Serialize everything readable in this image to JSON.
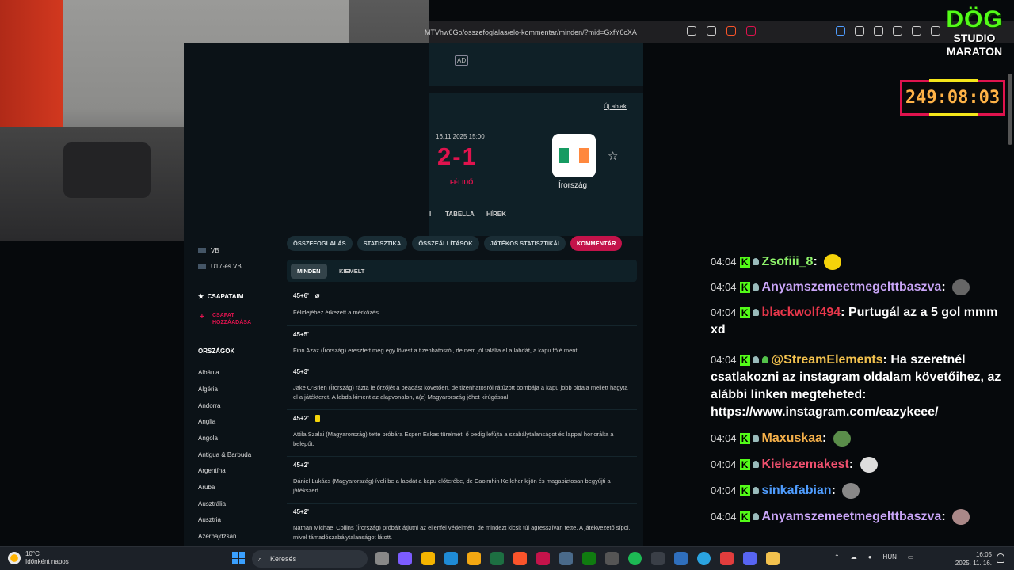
{
  "browser": {
    "url": "MTVhw6Go/osszefoglalas/elo-kommentar/minden/?mid=GxfY6cXA"
  },
  "ad_label": "AD",
  "match": {
    "new_window": "Új ablak",
    "date": "16.11.2025 15:00",
    "score": "2-1",
    "status": "FÉLIDŐ",
    "away_team": "Írország",
    "flag_colors": [
      "#169b62",
      "#ffffff",
      "#ff883e"
    ]
  },
  "tabs": {
    "partial": "I",
    "table": "TABELLA",
    "news": "HÍREK"
  },
  "subtabs": [
    "ÖSSZEFOGLALÁS",
    "STATISZTIKA",
    "ÖSSZEÁLLÍTÁSOK",
    "JÁTÉKOS STATISZTIKÁI",
    "KOMMENTÁR"
  ],
  "filters": {
    "all": "MINDEN",
    "highlighted": "KIEMELT"
  },
  "comments": [
    {
      "time": "45+6'",
      "text": "Félidejéhez érkezett a mérkőzés."
    },
    {
      "time": "45+5'",
      "text": "Finn Azaz (Írország) eresztett meg egy lövést a tizenhatosról, de nem jól találta el a labdát, a kapu fölé ment."
    },
    {
      "time": "45+3'",
      "text": "Jake O'Brien (Írország) rázta le őrzőjét a beadást követően, de tizenhatosról rátűzött bombája a kapu jobb oldala mellett hagyta el a játékteret. A labda kiment az alapvonalon, a(z) Magyarország jöhet kirúgással."
    },
    {
      "time": "45+2'",
      "text": "Attila Szalai (Magyarország) tette próbára Espen Eskas türelmét, ő pedig lefújta a szabálytalanságot és lappal honorálta a belépőt."
    },
    {
      "time": "45+2'",
      "text": "Dániel Lukács (Magyarország) íveli be a labdát a kapu előterébe, de Caoimhin Kelleher kijön és magabiztosan begyűjti a játékszert."
    },
    {
      "time": "45+2'",
      "text": "Nathan Michael Collins (Írország) próbált átjutni az ellenfél védelmén, de mindezt kicsit túl agresszívan tette. A játékvezető sípol, mivel támadószabálytalanságot látott."
    }
  ],
  "leftnav": {
    "competitions": [
      "VB",
      "U17-es VB"
    ],
    "my_teams": "CSAPATAIM",
    "add_team": "CSAPAT HOZZÁADÁSA",
    "countries_header": "ORSZÁGOK",
    "countries": [
      "Albánia",
      "Algéria",
      "Andorra",
      "Anglia",
      "Angola",
      "Antigua & Barbuda",
      "Argentína",
      "Aruba",
      "Ausztrália",
      "Ausztria",
      "Azerbajdzsán"
    ]
  },
  "chat": [
    {
      "time": "04:04",
      "user": "Zsofiii_8",
      "color": "#8ef36b",
      "text": ""
    },
    {
      "time": "04:04",
      "user": "Anyamszemeetmegelttbaszva",
      "color": "#c9a5f7",
      "text": ""
    },
    {
      "time": "04:04",
      "user": "blackwolf494",
      "color": "#e8374b",
      "text": "Purtugál az a 5 gol mmm xd"
    },
    {
      "time": "04:04",
      "user": "@StreamElements",
      "color": "#f2c14e",
      "text": "Ha szeretnél csatlakozni az instagram oldalam követőihez, az alábbi linken megteheted: https://www.instagram.com/eazykeee/"
    },
    {
      "time": "04:04",
      "user": "Maxuskaa",
      "color": "#f5b04a",
      "text": ""
    },
    {
      "time": "04:04",
      "user": "Kielezemakest",
      "color": "#f0506e",
      "text": ""
    },
    {
      "time": "04:04",
      "user": "sinkafabian",
      "color": "#4f9dff",
      "text": ""
    },
    {
      "time": "04:04",
      "user": "Anyamszemeetmegelttbaszva",
      "color": "#c9a5f7",
      "text": ""
    }
  ],
  "overlay": {
    "logo_line1": "DÖG",
    "logo_line2": "STUDIO",
    "logo_line3": "MARATON",
    "timer": "249:08:03"
  },
  "taskbar": {
    "temp": "10°C",
    "weather": "Időnként napos",
    "search": "Keresés",
    "lang": "HUN",
    "time": "16:05",
    "date": "2025. 11. 16."
  }
}
